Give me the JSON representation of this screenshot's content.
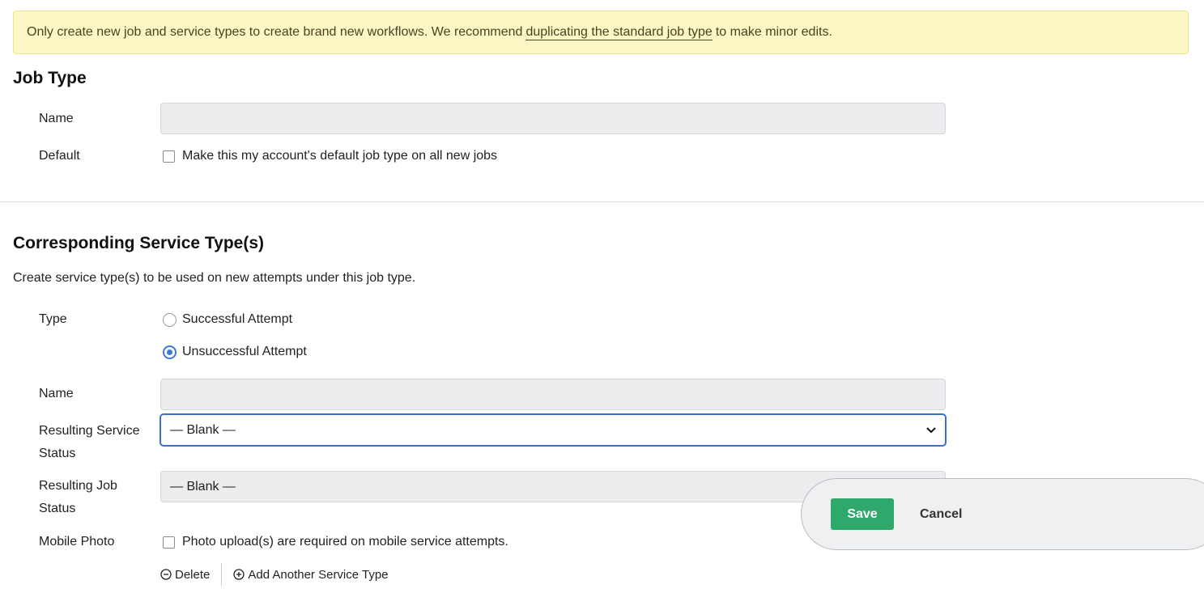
{
  "notice": {
    "text_before": "Only create new job and service types to create brand new workflows. We recommend",
    "link": "duplicating the standard job type",
    "text_after": "to make minor edits."
  },
  "job_type": {
    "heading": "Job Type",
    "name_label": "Name",
    "name_value": "",
    "default_label": "Default",
    "default_checkbox_label": "Make this my account's default job type on all new jobs",
    "default_checked": false
  },
  "service_types": {
    "heading": "Corresponding Service Type(s)",
    "description": "Create service type(s) to be used on new attempts under this job type.",
    "type_label": "Type",
    "type_options": [
      "Successful Attempt",
      "Unsuccessful Attempt"
    ],
    "type_selected": "Unsuccessful Attempt",
    "name_label": "Name",
    "name_value": "",
    "resulting_service_status_label_1": "Resulting Service",
    "resulting_service_status_label_2": "Status",
    "resulting_service_status_value": "— Blank —",
    "resulting_job_status_label_1": "Resulting Job",
    "resulting_job_status_label_2": "Status",
    "resulting_job_status_value": "— Blank —",
    "mobile_photo_label": "Mobile Photo",
    "mobile_photo_checkbox_label": "Photo upload(s) are required on mobile service attempts.",
    "mobile_photo_checked": false,
    "delete_label": "Delete",
    "add_another_label": "Add Another Service Type"
  },
  "footer": {
    "save_label": "Save",
    "cancel_label": "Cancel"
  },
  "colors": {
    "accent": "#3b79d8",
    "save": "#2fa86b",
    "notice_bg": "#fcf8c6"
  }
}
